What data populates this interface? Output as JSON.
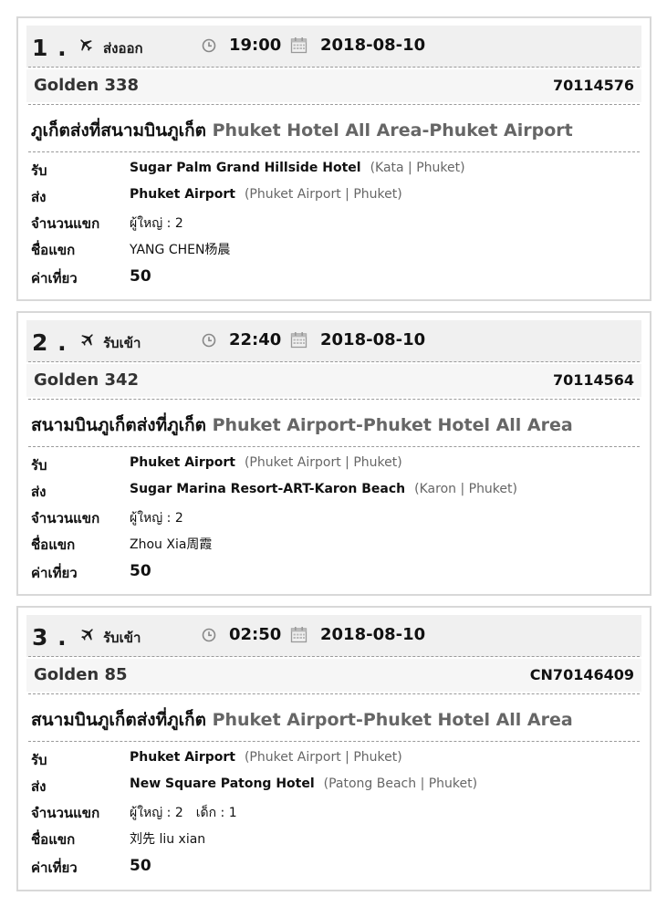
{
  "labels": {
    "pickup": "รับ",
    "dropoff": "ส่ง",
    "guest_count": "จำนวนแขก",
    "guest_name": "ชื่อแขก",
    "fare": "ค่าเที่ยว"
  },
  "bookings": [
    {
      "number": "1 .",
      "type_icon": "plane-takeoff-icon",
      "type_label": "ส่งออก",
      "time": "19:00",
      "date": "2018-08-10",
      "vehicle": "Golden 338",
      "code": "70114576",
      "route_th": "ภูเก็ตส่งที่สนามบินภูเก็ต",
      "route_en": "Phuket Hotel All Area-Phuket Airport",
      "pickup_place": "Sugar Palm Grand Hillside Hotel",
      "pickup_loc": "(Kata | Phuket)",
      "dropoff_place": "Phuket Airport",
      "dropoff_loc": "(Phuket Airport | Phuket)",
      "guests_adult": "ผู้ใหญ่ : 2",
      "guests_child": "",
      "guest_name": "YANG CHEN杨晨",
      "fare": "50"
    },
    {
      "number": "2 .",
      "type_icon": "plane-landing-icon",
      "type_label": "รับเข้า",
      "time": "22:40",
      "date": "2018-08-10",
      "vehicle": "Golden 342",
      "code": "70114564",
      "route_th": "สนามบินภูเก็ตส่งที่ภูเก็ต",
      "route_en": "Phuket Airport-Phuket Hotel All Area",
      "pickup_place": "Phuket Airport",
      "pickup_loc": "(Phuket Airport | Phuket)",
      "dropoff_place": "Sugar Marina Resort-ART-Karon Beach",
      "dropoff_loc": "(Karon | Phuket)",
      "guests_adult": "ผู้ใหญ่ : 2",
      "guests_child": "",
      "guest_name": "Zhou Xia周霞",
      "fare": "50"
    },
    {
      "number": "3 .",
      "type_icon": "plane-landing-icon",
      "type_label": "รับเข้า",
      "time": "02:50",
      "date": "2018-08-10",
      "vehicle": "Golden 85",
      "code": "CN70146409",
      "route_th": "สนามบินภูเก็ตส่งที่ภูเก็ต",
      "route_en": "Phuket Airport-Phuket Hotel All Area",
      "pickup_place": "Phuket Airport",
      "pickup_loc": "(Phuket Airport | Phuket)",
      "dropoff_place": "New Square Patong Hotel",
      "dropoff_loc": "(Patong Beach | Phuket)",
      "guests_adult": "ผู้ใหญ่ : 2",
      "guests_child": "เด็ก : 1",
      "guest_name": "刘先 liu xian",
      "fare": "50"
    }
  ]
}
